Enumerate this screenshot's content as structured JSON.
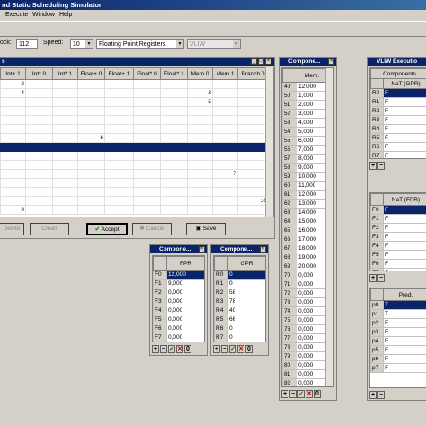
{
  "app": {
    "title": "nd Static Scheduling Simulator"
  },
  "menu": [
    "Execute",
    "Window",
    "Help"
  ],
  "toolbar": {
    "clock_label": "ock:",
    "clock_value": "112",
    "speed_label": "Speed:",
    "speed_value": "10",
    "view_select": "Floating Point Registers",
    "mode_select": "VLIW"
  },
  "main_window": {
    "title": "s",
    "columns": [
      "Int+ 1",
      "Int* 0",
      "Int* 1",
      "Float+ 0",
      "Float+ 1",
      "Float* 0",
      "Float* 1",
      "Mem 0",
      "Mem 1",
      "Branch 0"
    ],
    "rows": [
      [
        "2",
        "",
        "",
        "",
        "",
        "",
        "",
        "",
        "",
        ""
      ],
      [
        "4",
        "",
        "",
        "",
        "",
        "",
        "",
        "3",
        "",
        ""
      ],
      [
        "",
        "",
        "",
        "",
        "",
        "",
        "",
        "5",
        "",
        ""
      ],
      [
        "",
        "",
        "",
        "",
        "",
        "",
        "",
        "",
        "",
        ""
      ],
      [
        "",
        "",
        "",
        "",
        "",
        "",
        "",
        "",
        "",
        ""
      ],
      [
        "",
        "",
        "",
        "",
        "",
        "",
        "",
        "",
        "",
        ""
      ],
      [
        "",
        "",
        "",
        "6",
        "",
        "",
        "",
        "",
        "",
        ""
      ],
      [
        "",
        "",
        "",
        "",
        "",
        "",
        "",
        "",
        "",
        ""
      ],
      [
        "",
        "",
        "",
        "",
        "",
        "",
        "",
        "",
        "",
        ""
      ],
      [
        "",
        "",
        "",
        "",
        "",
        "",
        "",
        "",
        "",
        ""
      ],
      [
        "",
        "",
        "",
        "",
        "",
        "",
        "",
        "",
        "7",
        ""
      ],
      [
        "",
        "",
        "",
        "",
        "",
        "",
        "",
        "",
        "",
        ""
      ],
      [
        "",
        "",
        "",
        "",
        "",
        "",
        "",
        "",
        "",
        ""
      ],
      [
        "",
        "",
        "",
        "",
        "",
        "",
        "",
        "",
        "",
        "10"
      ],
      [
        "9",
        "",
        "",
        "",
        "",
        "",
        "",
        "",
        "",
        ""
      ]
    ],
    "buttons": {
      "delete": "Delete",
      "clean": "Clean",
      "accept": "Accept",
      "cancel": "Cancel",
      "save": "Save"
    }
  },
  "mem_window": {
    "title": "Compone...",
    "header": "Mem.",
    "rows": [
      [
        "40",
        "12,000"
      ],
      [
        "50",
        "1,000"
      ],
      [
        "51",
        "2,000"
      ],
      [
        "52",
        "3,000"
      ],
      [
        "53",
        "4,000"
      ],
      [
        "54",
        "5,000"
      ],
      [
        "55",
        "6,000"
      ],
      [
        "56",
        "7,000"
      ],
      [
        "57",
        "8,000"
      ],
      [
        "58",
        "9,000"
      ],
      [
        "59",
        "10,000"
      ],
      [
        "60",
        "11,000"
      ],
      [
        "61",
        "12,000"
      ],
      [
        "62",
        "13,000"
      ],
      [
        "63",
        "14,000"
      ],
      [
        "64",
        "15,000"
      ],
      [
        "65",
        "16,000"
      ],
      [
        "66",
        "17,000"
      ],
      [
        "67",
        "18,000"
      ],
      [
        "68",
        "19,000"
      ],
      [
        "69",
        "20,000"
      ],
      [
        "70",
        "0,000"
      ],
      [
        "71",
        "0,000"
      ],
      [
        "72",
        "0,000"
      ],
      [
        "73",
        "0,000"
      ],
      [
        "74",
        "0,000"
      ],
      [
        "75",
        "0,000"
      ],
      [
        "76",
        "0,000"
      ],
      [
        "77",
        "0,000"
      ],
      [
        "78",
        "0,000"
      ],
      [
        "79",
        "0,000"
      ],
      [
        "80",
        "0,000"
      ],
      [
        "81",
        "0,000"
      ],
      [
        "82",
        "0,000"
      ],
      [
        "83",
        "0,000"
      ],
      [
        "84",
        "0,000"
      ]
    ]
  },
  "fpr_window": {
    "title": "Compone...",
    "header": "FPR",
    "rows": [
      [
        "F0",
        "12,000"
      ],
      [
        "F1",
        "9,000"
      ],
      [
        "F2",
        "0,000"
      ],
      [
        "F3",
        "0,000"
      ],
      [
        "F4",
        "0,000"
      ],
      [
        "F5",
        "0,000"
      ],
      [
        "F6",
        "0,000"
      ],
      [
        "F7",
        "0,000"
      ]
    ]
  },
  "gpr_window": {
    "title": "Compone...",
    "header": "GPR",
    "rows": [
      [
        "R0",
        "0"
      ],
      [
        "R1",
        "0"
      ],
      [
        "R2",
        "58"
      ],
      [
        "R3",
        "78"
      ],
      [
        "R4",
        "40"
      ],
      [
        "R5",
        "66"
      ],
      [
        "R6",
        "0"
      ],
      [
        "R7",
        "0"
      ]
    ]
  },
  "vliw_window": {
    "title": "VLIW Executio",
    "gpr_section": {
      "title": "Components",
      "header": "NaT (GPR)",
      "rows": [
        [
          "R0",
          "F"
        ],
        [
          "R1",
          "F"
        ],
        [
          "R2",
          "F"
        ],
        [
          "R3",
          "F"
        ],
        [
          "R4",
          "F"
        ],
        [
          "R5",
          "F"
        ],
        [
          "R6",
          "F"
        ],
        [
          "R7",
          "F"
        ]
      ]
    },
    "fpr_section": {
      "header": "NaT (FPR)",
      "rows": [
        [
          "F0",
          "F"
        ],
        [
          "F1",
          "F"
        ],
        [
          "F2",
          "F"
        ],
        [
          "F3",
          "F"
        ],
        [
          "F4",
          "F"
        ],
        [
          "F5",
          "F"
        ],
        [
          "F6",
          "F"
        ],
        [
          "F7",
          "F"
        ]
      ]
    },
    "pred_section": {
      "header": "Pred.",
      "rows": [
        [
          "p0",
          "T"
        ],
        [
          "p1",
          "T"
        ],
        [
          "p2",
          "F"
        ],
        [
          "p3",
          "F"
        ],
        [
          "p4",
          "F"
        ],
        [
          "p5",
          "F"
        ],
        [
          "p6",
          "F"
        ],
        [
          "p7",
          "F"
        ]
      ]
    }
  },
  "colors": {
    "title_bg": "#0a246a",
    "window_bg": "#d4d0c8",
    "selection": "#0a246a"
  }
}
